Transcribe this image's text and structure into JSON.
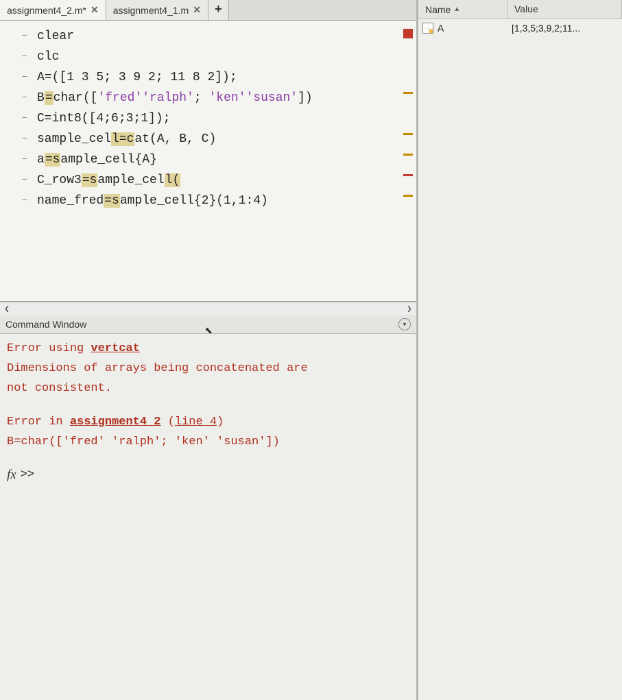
{
  "tabs": [
    {
      "label": "assignment4_2.m*",
      "active": true
    },
    {
      "label": "assignment4_1.m",
      "active": false
    }
  ],
  "editor": {
    "lines": [
      "clear",
      "clc",
      "A=([1 3 5; 3 9 2; 11 8 2]);",
      "B=char(['fred' 'ralph'; 'ken' 'susan'])",
      "C=int8([4;6;3;1]);",
      "sample_cell=cat(A, B, C)",
      "a=sample_cell{A}",
      "C_row3=sample_cell(",
      "name_fred=sample_cell{2}(1,1:4)"
    ],
    "lint": [
      "none",
      "none",
      "none",
      "warn",
      "none",
      "warn",
      "warn",
      "error",
      "warn"
    ]
  },
  "command_window": {
    "title": "Command Window",
    "lines": {
      "err1_prefix": "Error using ",
      "err1_link": "vertcat",
      "err2": "Dimensions of arrays being concatenated are",
      "err3": "not consistent.",
      "err4_prefix": "Error in ",
      "err4_link": "assignment4_2",
      "err4_paren_open": " (",
      "err4_line_link": "line 4",
      "err4_paren_close": ")",
      "err5": "B=char(['fred' 'ralph'; 'ken' 'susan'])"
    },
    "prompt": ">>"
  },
  "workspace": {
    "headers": {
      "name": "Name",
      "value": "Value"
    },
    "rows": [
      {
        "name": "A",
        "value": "[1,3,5;3,9,2;11..."
      }
    ]
  }
}
